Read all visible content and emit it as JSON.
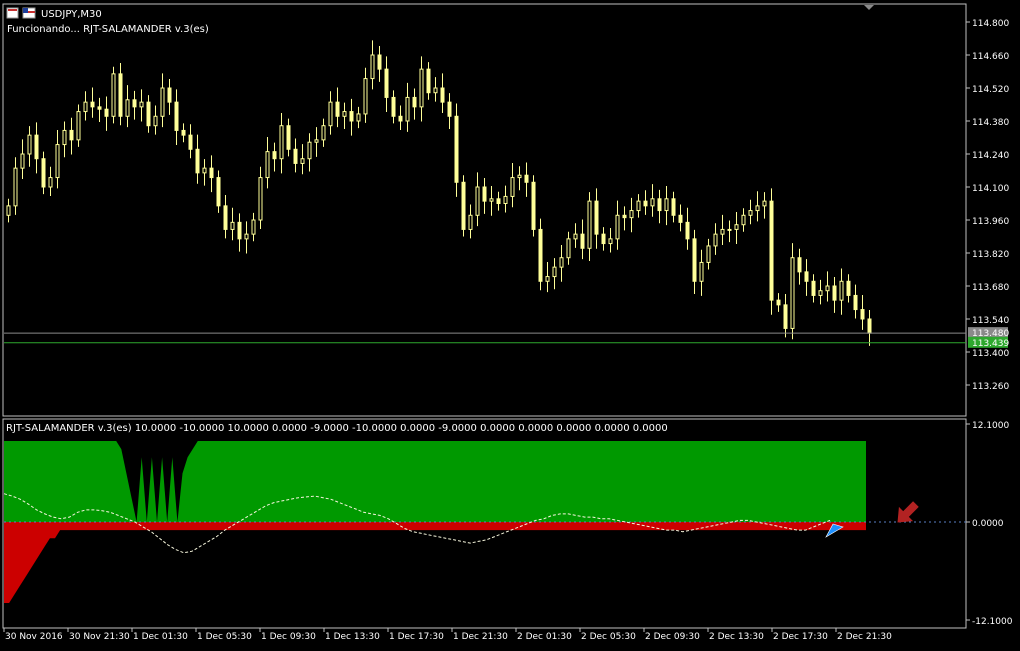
{
  "header": {
    "symbol_label": "USDJPY,M30",
    "status_label": "Funcionando... RJT-SALAMANDER v.3(es)"
  },
  "indicator": {
    "label": "RJT-SALAMANDER v.3(es) 10.0000 -10.0000 10.0000 0.0000 -9.0000 -10.0000 0.0000 -9.0000 0.0000 0.0000 0.0000 0.0000 0.0000"
  },
  "colors": {
    "background": "#000000",
    "candle": "#FFFF99",
    "green_area": "#009900",
    "red_area": "#CC0000",
    "signal_line": "#F5F5DC",
    "zero_line": "#5A7FC4",
    "ask_line": "#8A8A8A",
    "bid_line": "#2EA82E",
    "frame": "#C0C0C0",
    "down_arrow": "#B22222",
    "cursor_arrow": "#1E90FF"
  },
  "price_axis": {
    "ticks": [
      "114.800",
      "114.660",
      "114.520",
      "114.380",
      "114.240",
      "114.100",
      "113.960",
      "113.820",
      "113.680",
      "113.540",
      "113.400",
      "113.260"
    ],
    "ask_label": "113.480",
    "bid_label": "113.439"
  },
  "indicator_axis": {
    "ticks": [
      "12.1000",
      "0.0000",
      "-12.1000"
    ]
  },
  "time_axis": {
    "labels": [
      "30 Nov 2016",
      "30 Nov 21:30",
      "1 Dec 01:30",
      "1 Dec 05:30",
      "1 Dec 09:30",
      "1 Dec 13:30",
      "1 Dec 17:30",
      "1 Dec 21:30",
      "2 Dec 01:30",
      "2 Dec 05:30",
      "2 Dec 09:30",
      "2 Dec 13:30",
      "2 Dec 17:30",
      "2 Dec 21:30"
    ]
  },
  "chart_data": [
    {
      "type": "candlestick",
      "title": "USDJPY,M30",
      "ylim": [
        113.17,
        114.86
      ],
      "ask": 113.48,
      "bid": 113.439,
      "closes": [
        114.02,
        114.18,
        114.24,
        114.32,
        114.22,
        114.1,
        114.14,
        114.28,
        114.34,
        114.3,
        114.42,
        114.46,
        114.44,
        114.43,
        114.4,
        114.58,
        114.4,
        114.47,
        114.44,
        114.46,
        114.36,
        114.4,
        114.52,
        114.46,
        114.34,
        114.32,
        114.26,
        114.16,
        114.18,
        114.14,
        114.02,
        113.92,
        113.95,
        113.88,
        113.9,
        113.96,
        114.14,
        114.25,
        114.22,
        114.36,
        114.26,
        114.2,
        114.22,
        114.29,
        114.3,
        114.36,
        114.46,
        114.4,
        114.42,
        114.38,
        114.41,
        114.56,
        114.66,
        114.6,
        114.48,
        114.4,
        114.38,
        114.48,
        114.44,
        114.6,
        114.5,
        114.52,
        114.46,
        114.4,
        114.12,
        113.92,
        113.98,
        114.1,
        114.04,
        114.05,
        114.03,
        114.06,
        114.14,
        114.15,
        114.12,
        113.92,
        113.7,
        113.72,
        113.76,
        113.8,
        113.88,
        113.9,
        113.84,
        114.04,
        113.9,
        113.86,
        113.88,
        113.98,
        113.97,
        114.0,
        114.04,
        114.02,
        114.05,
        114.0,
        114.05,
        113.98,
        113.95,
        113.88,
        113.7,
        113.78,
        113.85,
        113.9,
        113.92,
        113.92,
        113.94,
        113.98,
        114.0,
        114.02,
        114.04,
        113.62,
        113.6,
        113.5,
        113.8,
        113.74,
        113.7,
        113.64,
        113.66,
        113.68,
        113.62,
        113.7,
        113.64,
        113.58,
        113.54,
        113.48
      ]
    },
    {
      "type": "area",
      "title": "RJT-SALAMANDER v.3(es)",
      "ylim": [
        -12.1,
        12.1
      ],
      "series": [
        {
          "color": "green",
          "values": [
            10,
            10,
            10,
            10,
            10,
            10,
            10,
            10,
            10,
            10,
            10,
            10,
            10,
            10,
            10,
            10,
            10,
            10,
            10,
            10,
            10,
            10,
            10,
            9,
            6,
            3,
            0,
            8,
            0,
            8,
            0,
            8,
            0,
            8,
            0,
            6,
            8,
            9,
            10,
            10,
            10,
            10,
            10,
            10,
            10,
            10,
            10,
            10,
            10,
            10,
            10,
            10,
            10,
            10,
            10,
            10,
            10,
            10,
            10,
            10,
            10,
            10,
            10,
            10,
            10,
            10,
            10,
            10,
            10,
            10,
            10,
            10,
            10,
            10,
            10,
            10,
            10,
            10,
            10,
            10,
            10,
            10,
            10,
            10,
            10,
            10,
            10,
            10,
            10,
            10,
            10,
            10,
            10,
            10,
            10,
            10,
            10,
            10,
            10,
            10,
            10,
            10,
            10,
            10,
            10,
            10,
            10,
            10,
            10,
            10,
            10,
            10,
            10,
            10,
            10,
            10,
            10,
            10,
            10,
            10,
            10,
            10,
            10,
            10,
            10,
            10,
            10,
            10,
            10,
            10,
            10,
            10,
            10,
            10,
            10,
            10,
            10,
            10,
            10,
            10,
            10,
            10,
            10,
            10,
            10,
            10,
            10,
            10,
            10,
            10,
            10,
            10,
            10,
            10,
            10,
            10,
            10,
            10,
            10,
            10,
            10,
            10,
            10,
            10,
            10,
            10,
            10,
            10,
            10,
            10
          ]
        },
        {
          "color": "red",
          "values": [
            -10,
            -10,
            -9,
            -8,
            -7,
            -6,
            -5,
            -4,
            -3,
            -2,
            -2,
            -1,
            -1,
            -1,
            -1,
            -1,
            -1,
            -1,
            -1,
            -1,
            -1,
            -1,
            -1,
            -1,
            -1,
            -1,
            -1,
            -1,
            -1,
            -1,
            -1,
            -1,
            -1,
            -1,
            -1,
            -1,
            -1,
            -1,
            -1,
            -1,
            -1,
            -1,
            -1,
            -1,
            -1,
            -1,
            -1,
            -1,
            -1,
            -1,
            -1,
            -1,
            -1,
            -1,
            -1,
            -1,
            -1,
            -1,
            -1,
            -1,
            -1,
            -1,
            -1,
            -1,
            -1,
            -1,
            -1,
            -1,
            -1,
            -1,
            -1,
            -1,
            -1,
            -1,
            -1,
            -1,
            -1,
            -1,
            -1,
            -1,
            -1,
            -1,
            -1,
            -1,
            -1,
            -1,
            -1,
            -1,
            -1,
            -1,
            -1,
            -1,
            -1,
            -1,
            -1,
            -1,
            -1,
            -1,
            -1,
            -1,
            -1,
            -1,
            -1,
            -1,
            -1,
            -1,
            -1,
            -1,
            -1,
            -1,
            -1,
            -1,
            -1,
            -1,
            -1,
            -1,
            -1,
            -1,
            -1,
            -1,
            -1,
            -1,
            -1,
            -1,
            -1,
            -1,
            -1,
            -1,
            -1,
            -1,
            -1,
            -1,
            -1,
            -1,
            -1,
            -1,
            -1,
            -1,
            -1,
            -1,
            -1,
            -1,
            -1,
            -1,
            -1,
            -1,
            -1,
            -1,
            -1,
            -1,
            -1,
            -1,
            -1,
            -1,
            -1,
            -1,
            -1,
            -1,
            -1,
            -1,
            -1,
            -1,
            -1,
            -1,
            -1,
            -1,
            -1,
            -1,
            -1,
            -1
          ]
        },
        {
          "name": "signal",
          "color": "dashed",
          "values": [
            3.5,
            3.2,
            2.8,
            2.2,
            1.5,
            1.0,
            0.6,
            0.4,
            0.6,
            1.2,
            1.5,
            1.5,
            1.4,
            1.2,
            0.8,
            0.4,
            0,
            -0.6,
            -1.2,
            -2.0,
            -2.8,
            -3.4,
            -3.8,
            -3.6,
            -3.0,
            -2.4,
            -1.8,
            -1.0,
            -0.4,
            0.2,
            0.8,
            1.4,
            2.0,
            2.4,
            2.6,
            2.8,
            3.0,
            3.1,
            3.2,
            3.0,
            2.8,
            2.4,
            2.0,
            1.6,
            1.2,
            1.0,
            0.8,
            0.4,
            -0.2,
            -0.8,
            -1.2,
            -1.4,
            -1.6,
            -1.8,
            -2.0,
            -2.2,
            -2.4,
            -2.6,
            -2.4,
            -2.2,
            -1.8,
            -1.4,
            -1.0,
            -0.6,
            -0.2,
            0.2,
            0.4,
            0.8,
            1.0,
            1.0,
            0.8,
            0.6,
            0.6,
            0.4,
            0.4,
            0.2,
            0.0,
            -0.2,
            -0.4,
            -0.6,
            -0.8,
            -1.0,
            -1.0,
            -1.2,
            -1.0,
            -0.8,
            -0.6,
            -0.4,
            -0.2,
            0.0,
            0.2,
            0.2,
            0.0,
            -0.2,
            -0.4,
            -0.6,
            -0.8,
            -1.0,
            -1.0,
            -0.6,
            -0.2,
            0.2
          ]
        }
      ]
    }
  ]
}
